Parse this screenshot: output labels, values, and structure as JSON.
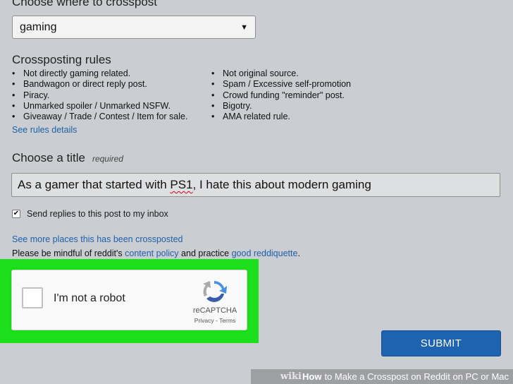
{
  "crosspost": {
    "heading": "Choose where to crosspost",
    "selected_community": "gaming",
    "caret": "▼"
  },
  "rules": {
    "heading": "Crossposting rules",
    "left": [
      "Not directly gaming related.",
      "Bandwagon or direct reply post.",
      "Piracy.",
      "Unmarked spoiler / Unmarked NSFW.",
      "Giveaway / Trade / Contest / Item for sale."
    ],
    "right": [
      "Not original source.",
      "Spam / Excessive self-promotion",
      "Crowd funding \"reminder\" post.",
      "Bigotry.",
      "AMA related rule."
    ],
    "details_link": "See rules details"
  },
  "title_section": {
    "heading": "Choose a title",
    "required": "required",
    "value_before": "As a gamer that started with ",
    "value_misspelled": "PS1",
    "value_after": ", I hate this about modern gaming"
  },
  "inbox": {
    "checked": true,
    "check_glyph": "✔",
    "label": "Send replies to this post to my inbox"
  },
  "links": {
    "more_places": "See more places this has been crossposted",
    "mindful_prefix": "Please be mindful of reddit's ",
    "content_policy": "content policy",
    "mindful_middle": " and practice ",
    "reddiquette": "good reddiquette",
    "mindful_suffix": "."
  },
  "captcha": {
    "label": "I'm not a robot",
    "brand": "reCAPTCHA",
    "links": "Privacy - Terms",
    "highlight_color": "#1be01b"
  },
  "submit": {
    "label": "SUBMIT",
    "color": "#1d63b0"
  },
  "watermark": {
    "wiki": "wiki",
    "how": "How",
    "rest": "to Make a Crosspost on Reddit on PC or Mac"
  }
}
